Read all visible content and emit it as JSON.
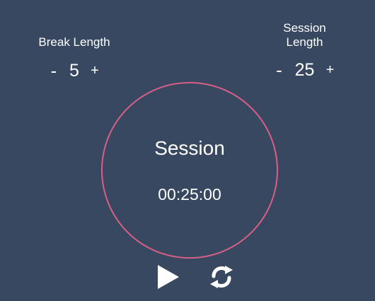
{
  "break": {
    "title": "Break Length",
    "decrement_label": "-",
    "value": "5",
    "increment_label": "+"
  },
  "session": {
    "title": "Session Length",
    "decrement_label": "-",
    "value": "25",
    "increment_label": "+"
  },
  "timer": {
    "label": "Session",
    "time": "00:25:00"
  },
  "controls": {
    "play_icon": "play-icon",
    "reset_icon": "refresh-icon"
  },
  "colors": {
    "background": "#374860",
    "accent": "#d85f87",
    "text": "#ffffff"
  }
}
